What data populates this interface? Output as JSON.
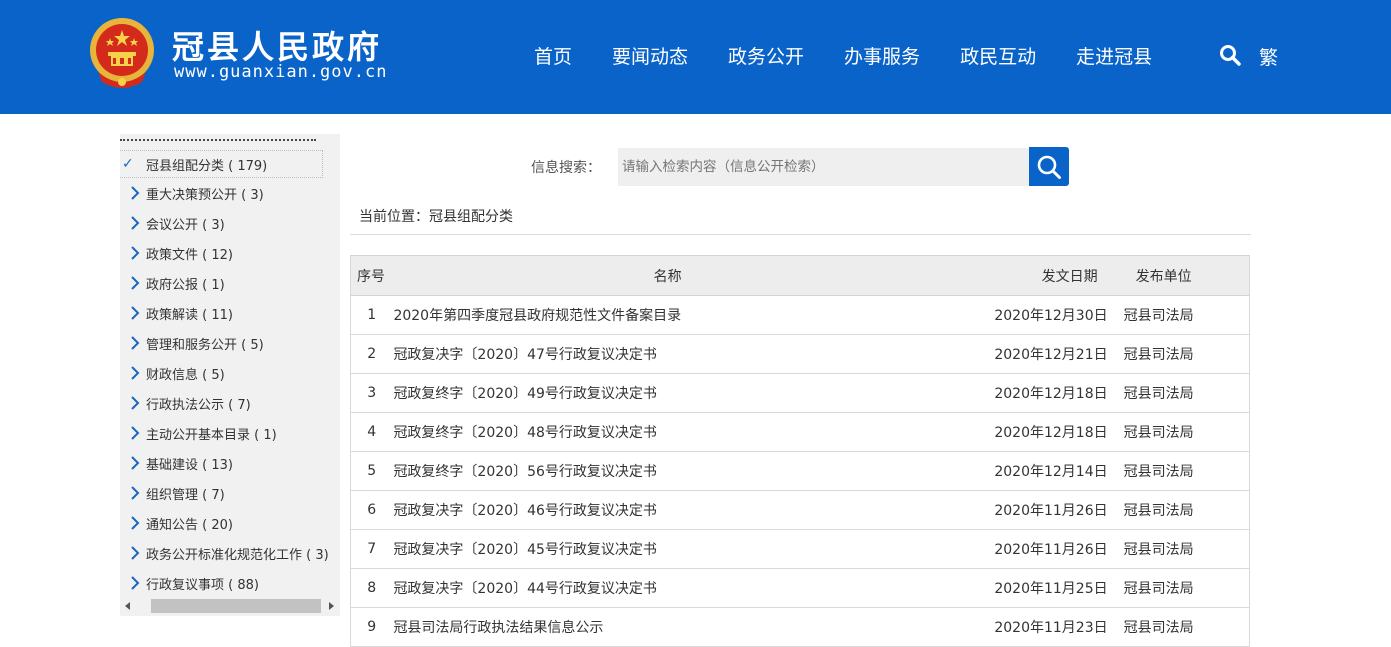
{
  "header": {
    "site_title": "冠县人民政府",
    "site_url": "www.guanxian.gov.cn",
    "nav": [
      "首页",
      "要闻动态",
      "政务公开",
      "办事服务",
      "政民互动",
      "走进冠县"
    ],
    "search_icon": "search-icon",
    "traditional_label": "繁",
    "brand_color": "#0a63c9"
  },
  "sidebar": {
    "root": "冠县组配分类 ( 179)",
    "items": [
      "重大决策预公开 ( 3)",
      "会议公开 ( 3)",
      "政策文件 ( 12)",
      "政府公报 ( 1)",
      "政策解读 ( 11)",
      "管理和服务公开 ( 5)",
      "财政信息 ( 5)",
      "行政执法公示 ( 7)",
      "主动公开基本目录 ( 1)",
      "基础建设 ( 13)",
      "组织管理 ( 7)",
      "通知公告 ( 20)",
      "政务公开标准化规范化工作 ( 3)",
      "行政复议事项 ( 88)"
    ]
  },
  "search": {
    "label": "信息搜索：",
    "placeholder": "请输入检索内容（信息公开检索）"
  },
  "breadcrumb": "当前位置：冠县组配分类",
  "table": {
    "headers": [
      "序号",
      "名称",
      "发文日期",
      "发布单位"
    ],
    "rows": [
      {
        "no": "1",
        "name": "2020年第四季度冠县政府规范性文件备案目录",
        "date": "2020年12月30日",
        "org": "冠县司法局"
      },
      {
        "no": "2",
        "name": "冠政复决字〔2020〕47号行政复议决定书",
        "date": "2020年12月21日",
        "org": "冠县司法局"
      },
      {
        "no": "3",
        "name": "冠政复终字〔2020〕49号行政复议决定书",
        "date": "2020年12月18日",
        "org": "冠县司法局"
      },
      {
        "no": "4",
        "name": "冠政复终字〔2020〕48号行政复议决定书",
        "date": "2020年12月18日",
        "org": "冠县司法局"
      },
      {
        "no": "5",
        "name": "冠政复终字〔2020〕56号行政复议决定书",
        "date": "2020年12月14日",
        "org": "冠县司法局"
      },
      {
        "no": "6",
        "name": "冠政复决字〔2020〕46号行政复议决定书",
        "date": "2020年11月26日",
        "org": "冠县司法局"
      },
      {
        "no": "7",
        "name": "冠政复决字〔2020〕45号行政复议决定书",
        "date": "2020年11月26日",
        "org": "冠县司法局"
      },
      {
        "no": "8",
        "name": "冠政复决字〔2020〕44号行政复议决定书",
        "date": "2020年11月25日",
        "org": "冠县司法局"
      },
      {
        "no": "9",
        "name": "冠县司法局行政执法结果信息公示",
        "date": "2020年11月23日",
        "org": "冠县司法局"
      }
    ]
  }
}
